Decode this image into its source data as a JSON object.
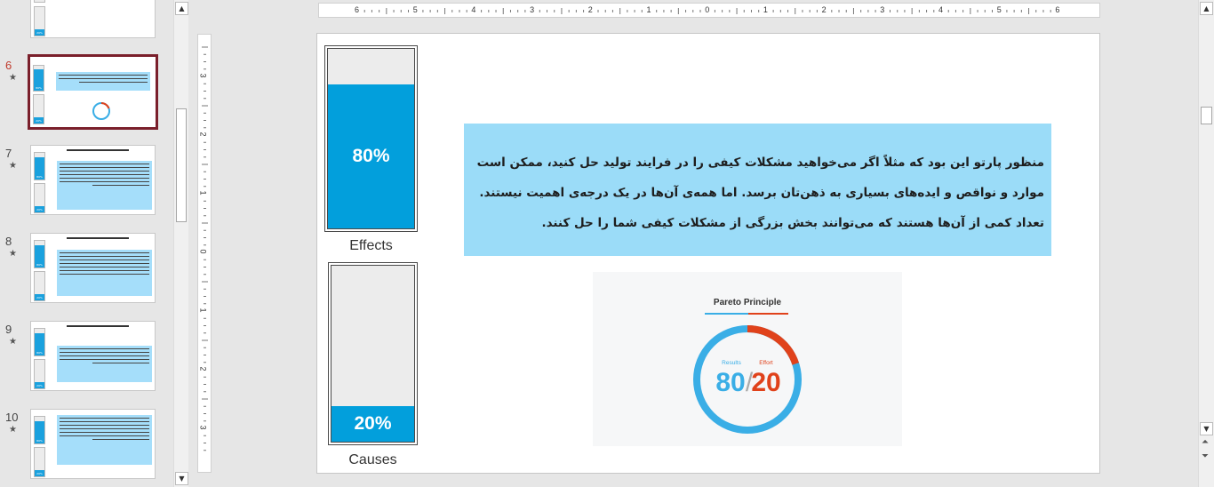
{
  "thumbnails": [
    {
      "number": "",
      "has_star": false,
      "bar_top_label": "",
      "bar_bottom_label": "20%",
      "variant": "text"
    },
    {
      "number": "6",
      "has_star": true,
      "bar_top_label": "80%",
      "bar_bottom_label": "20%",
      "variant": "pareto",
      "selected": true
    },
    {
      "number": "7",
      "has_star": true,
      "bar_top_label": "80%",
      "bar_bottom_label": "20%",
      "variant": "long"
    },
    {
      "number": "8",
      "has_star": true,
      "bar_top_label": "80%",
      "bar_bottom_label": "20%",
      "variant": "long"
    },
    {
      "number": "9",
      "has_star": true,
      "bar_top_label": "80%",
      "bar_bottom_label": "20%",
      "variant": "text"
    },
    {
      "number": "10",
      "has_star": true,
      "bar_top_label": "80%",
      "bar_bottom_label": "20%",
      "variant": "text"
    }
  ],
  "ruler": {
    "horizontal_labels": [
      "6",
      "5",
      "4",
      "3",
      "2",
      "1",
      "0",
      "1",
      "2",
      "3",
      "4",
      "5",
      "6"
    ],
    "vertical_labels": [
      "3",
      "2",
      "1",
      "0",
      "1",
      "2",
      "3"
    ]
  },
  "slide": {
    "effects_bar": {
      "percent_label": "80%",
      "fill": 0.8,
      "caption": "Effects"
    },
    "causes_bar": {
      "percent_label": "20%",
      "fill": 0.2,
      "caption": "Causes"
    },
    "body_text": {
      "line1": "منظور پارتو این بود که مثلاً اگر می‌خواهید مشکلات کیفی را در فرایند تولید حل کنید، ممکن است",
      "line2": "موارد و نواقص و ایده‌های بسیاری به ذهن‌تان برسد. اما همه‌ی آن‌ها در یک درجه‌ی اهمیت نیستند.",
      "line3": "تعداد کمی از آن‌ها هستند که می‌توانند بخش بزرگی از مشکلات کیفی شما را حل کنند."
    },
    "pareto_image": {
      "title": "Pareto Principle",
      "results_label": "Results",
      "effort_label": "Effort",
      "results_value": "80",
      "slash": "/",
      "effort_value": "20",
      "results_fraction": 0.8,
      "results_color": "#3aaee6",
      "effort_color": "#e0421b"
    }
  },
  "colors": {
    "bar_fill": "#029fdc",
    "text_box": "#9bdcf8",
    "selected_thumb_border": "#7a1f2b",
    "active_number": "#c0392b"
  }
}
